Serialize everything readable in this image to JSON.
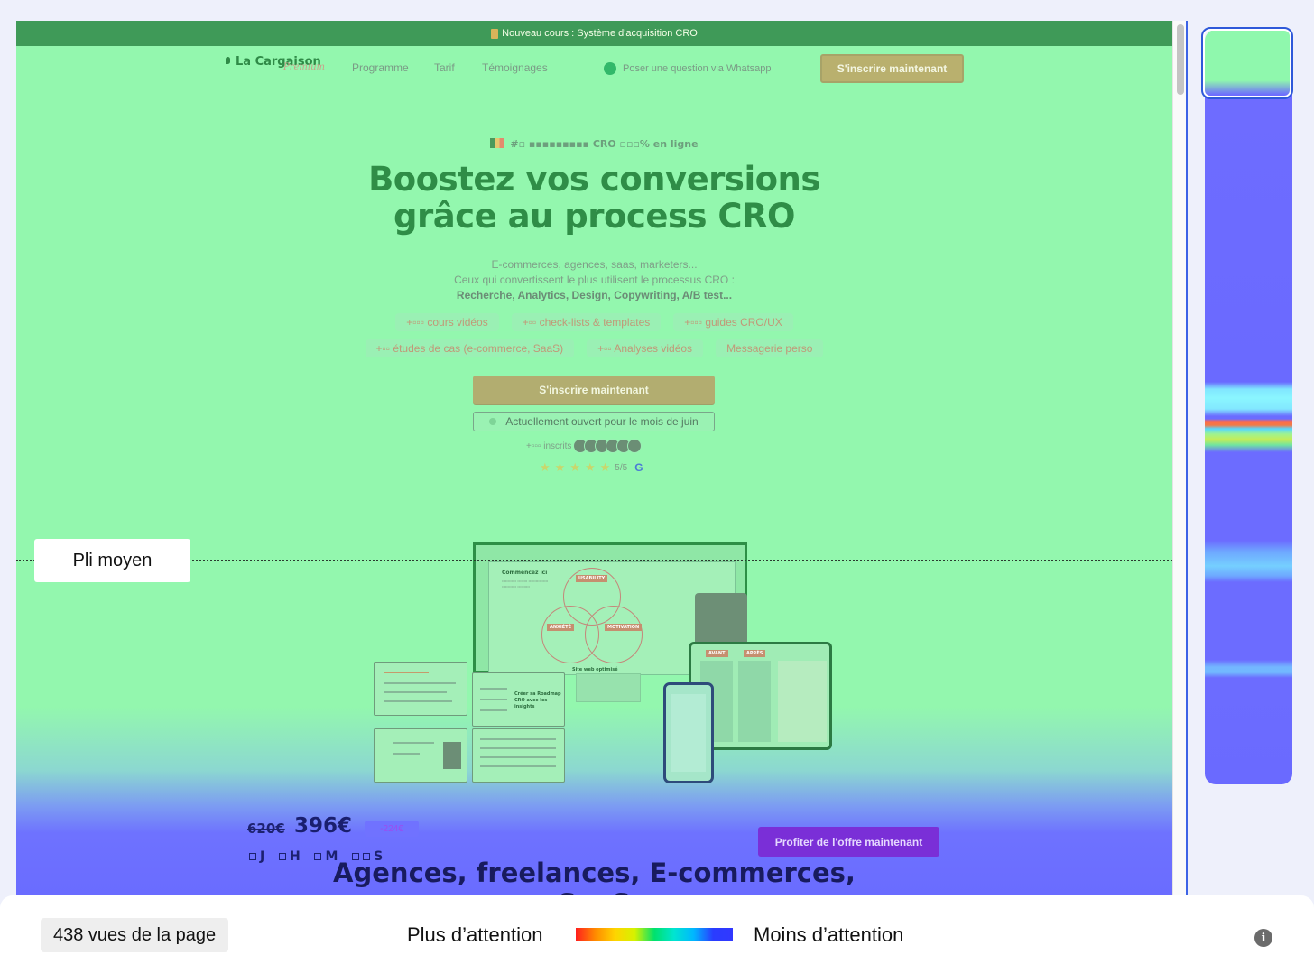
{
  "banner": {
    "text": "Nouveau cours : Système d'acquisition CRO"
  },
  "nav": {
    "logo": "La Cargaison",
    "logo_sub": "Premium",
    "links": [
      "Programme",
      "Tarif",
      "Témoignages"
    ],
    "whatsapp": "Poser une question via Whatsapp",
    "cta": "S'inscrire maintenant"
  },
  "hero": {
    "tag": "#▫ ▪▪▪▪▪▪▪▪▪ CRO ▫▫▫% en ligne",
    "title_line1": "Boostez vos conversions",
    "title_line2": "grâce au process CRO",
    "desc_line1": "E-commerces, agences, saas, marketers...",
    "desc_line2": "Ceux qui convertissent le plus utilisent le processus CRO :",
    "desc_line3": "Recherche, Analytics, Design, Copywriting, A/B test...",
    "chips_row1": [
      "+▫▫▫ cours vidéos",
      "+▫▫ check-lists & templates",
      "+▫▫▫ guides CRO/UX"
    ],
    "chips_row2": [
      "+▫▫ études de cas (e-commerce, SaaS)",
      "+▫▫ Analyses vidéos",
      "Messagerie perso"
    ],
    "cta": "S'inscrire maintenant",
    "open_note": "Actuellement ouvert pour le mois de juin",
    "signups": "+▫▫▫ inscrits",
    "rating": "5/5",
    "rating_value": 5,
    "rating_max": 5
  },
  "mockup": {
    "heading": "Commencez ici",
    "venn_labels": [
      "USABILITY",
      "ANXIÉTÉ",
      "MOTIVATION"
    ],
    "venn_caption": "Site web optimisé",
    "roadmap_card": "Créer sa Roadmap CRO avec les insights",
    "tablet_tabs": [
      "AVANT",
      "APRÈS"
    ]
  },
  "fold": {
    "label": "Pli moyen"
  },
  "pricing": {
    "old_price": "620€",
    "new_price": "396€",
    "discount": "-224€",
    "countdown": [
      "J",
      "H",
      "M",
      "S"
    ],
    "cta": "Profiter de l'offre maintenant"
  },
  "section": {
    "title_line1": "Agences, freelances, E-commerces,",
    "title_line2": "SaaS"
  },
  "footer": {
    "views": "438 vues de la page",
    "legend_more": "Plus d’attention",
    "legend_less": "Moins d’attention",
    "info_icon": "i"
  },
  "colors": {
    "heat_high": "#93f7ae",
    "heat_low": "#6a6cff",
    "banner_bg": "#3f9a58",
    "hero_title": "#2f8d47",
    "offer_cta": "#7a2fd7",
    "minimap_frame": "#2f59d9"
  },
  "icons": [
    "book-icon",
    "pin-icon",
    "whatsapp-icon",
    "flag-icon",
    "status-dot-icon",
    "star-icon",
    "google-icon",
    "info-icon"
  ]
}
